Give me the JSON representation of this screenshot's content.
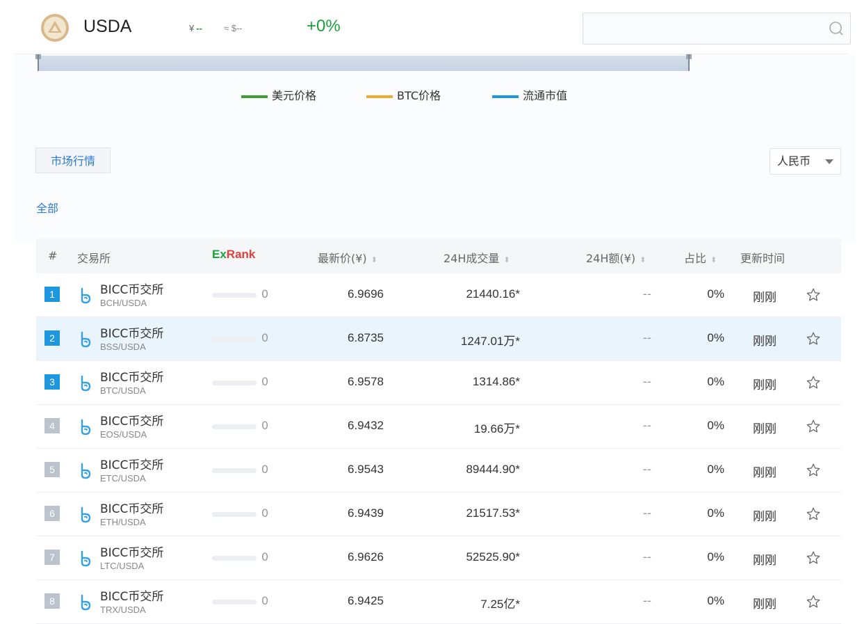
{
  "header": {
    "coin_name": "USDA",
    "price_cny_symbol": "¥",
    "price_cny_value": "--",
    "price_usd": "≈ $--",
    "change": "+0%",
    "search_placeholder": ""
  },
  "legend": [
    {
      "label": "美元价格",
      "color": "#3aa02f"
    },
    {
      "label": "BTC价格",
      "color": "#f0a830"
    },
    {
      "label": "流通市值",
      "color": "#1f96e0"
    }
  ],
  "tabs": {
    "market": "市场行情"
  },
  "currency": {
    "selected": "人民币"
  },
  "filter": {
    "all": "全部"
  },
  "table": {
    "headers": {
      "rank": "#",
      "exchange": "交易所",
      "exrank_ex": "Ex",
      "exrank_rank": "Rank",
      "price": "最新价(¥)",
      "volume": "24H成交量",
      "amount": "24H额(¥)",
      "share": "占比",
      "updated": "更新时间"
    },
    "rows": [
      {
        "rank": "1",
        "name": "BICC币交所",
        "pair": "BCH/USDA",
        "exrank": "0",
        "price": "6.9696",
        "volume": "21440.16*",
        "amount": "--",
        "share": "0%",
        "updated": "刚刚"
      },
      {
        "rank": "2",
        "name": "BICC币交所",
        "pair": "BSS/USDA",
        "exrank": "0",
        "price": "6.8735",
        "volume": "1247.01万*",
        "amount": "--",
        "share": "0%",
        "updated": "刚刚"
      },
      {
        "rank": "3",
        "name": "BICC币交所",
        "pair": "BTC/USDA",
        "exrank": "0",
        "price": "6.9578",
        "volume": "1314.86*",
        "amount": "--",
        "share": "0%",
        "updated": "刚刚"
      },
      {
        "rank": "4",
        "name": "BICC币交所",
        "pair": "EOS/USDA",
        "exrank": "0",
        "price": "6.9432",
        "volume": "19.66万*",
        "amount": "--",
        "share": "0%",
        "updated": "刚刚"
      },
      {
        "rank": "5",
        "name": "BICC币交所",
        "pair": "ETC/USDA",
        "exrank": "0",
        "price": "6.9543",
        "volume": "89444.90*",
        "amount": "--",
        "share": "0%",
        "updated": "刚刚"
      },
      {
        "rank": "6",
        "name": "BICC币交所",
        "pair": "ETH/USDA",
        "exrank": "0",
        "price": "6.9439",
        "volume": "21517.53*",
        "amount": "--",
        "share": "0%",
        "updated": "刚刚"
      },
      {
        "rank": "7",
        "name": "BICC币交所",
        "pair": "LTC/USDA",
        "exrank": "0",
        "price": "6.9626",
        "volume": "52525.90*",
        "amount": "--",
        "share": "0%",
        "updated": "刚刚"
      },
      {
        "rank": "8",
        "name": "BICC币交所",
        "pair": "TRX/USDA",
        "exrank": "0",
        "price": "6.9425",
        "volume": "7.25亿*",
        "amount": "--",
        "share": "0%",
        "updated": "刚刚"
      }
    ]
  },
  "colors": {
    "rank_top": "#1f96e0",
    "rank_other": "#bcc3cc",
    "accent_blue": "#2d7bd0",
    "positive_green": "#1ba33a",
    "row_highlight": "#eaf4fd"
  }
}
